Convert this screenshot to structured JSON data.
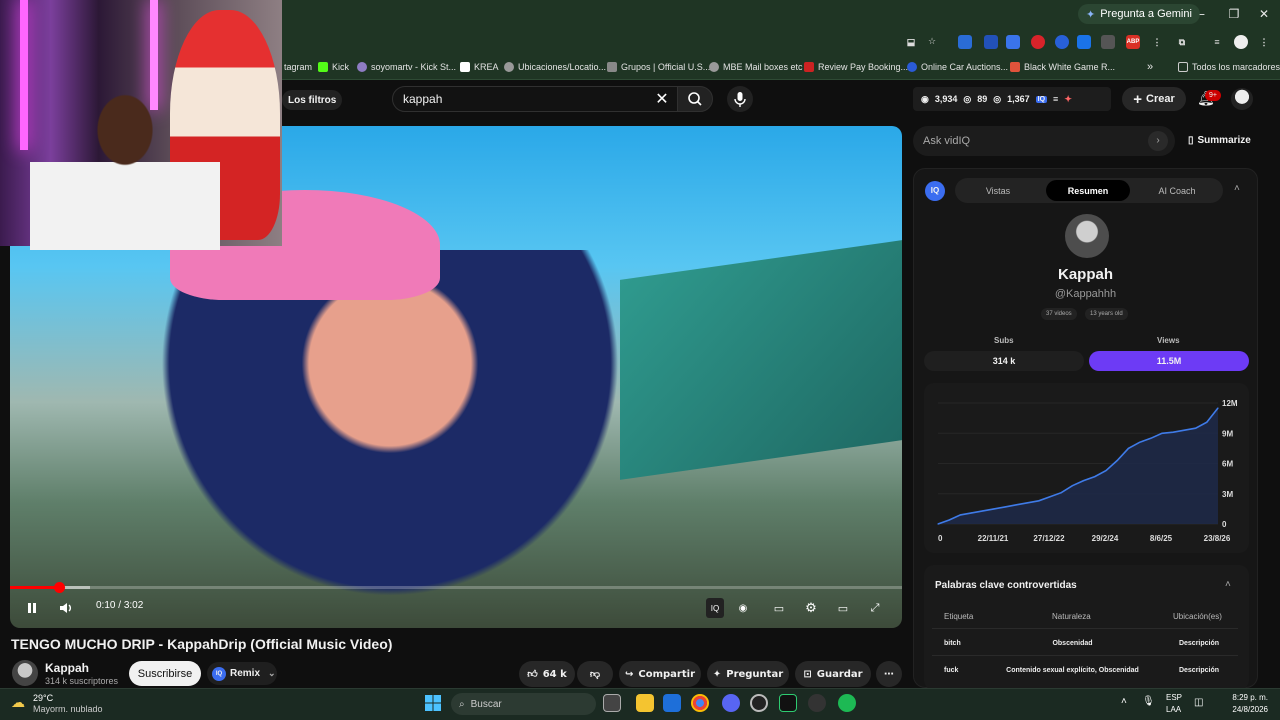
{
  "browser": {
    "gemini_label": "Pregunta a Gemini",
    "bookmarks": [
      "tagram",
      "Kick",
      "soyomartv - Kick St...",
      "KREA",
      "Ubicaciones/Locatio...",
      "Grupos | Official U.S...",
      "MBE Mail boxes etc",
      "Review Pay Booking...",
      "Online Car Auctions...",
      "Black White Game R..."
    ],
    "all_bookmarks": "Todos los marcadores",
    "overflow": "»"
  },
  "header": {
    "filters_label": "Los filtros",
    "search_value": "kappah",
    "stats": {
      "subs": "3,934",
      "eye": "89",
      "views": "1,367"
    },
    "create_label": "Crear",
    "notif_count": "9+"
  },
  "player": {
    "time_current": "0:10",
    "time_total": "3:02",
    "time_sep": " / ",
    "progress_fraction": 0.055,
    "buffer_fraction": 0.09
  },
  "video": {
    "title": "TENGO MUCHO DRIP - KappahDrip (Official Music Video)",
    "channel": "Kappah",
    "subscribers": "314 k suscriptores",
    "subscribe_label": "Suscribirse",
    "remix_label": "Remix",
    "likes": "64 k",
    "share_label": "Compartir",
    "ask_label": "Preguntar",
    "save_label": "Guardar"
  },
  "sidebar": {
    "ask_placeholder": "Ask vidIQ",
    "summarize_label": "Summarize",
    "tabs": [
      "Vistas",
      "Resumen",
      "AI Coach"
    ],
    "active_tab": 1,
    "channel_name": "Kappah",
    "channel_handle": "@Kappahhh",
    "chip_videos": "37 videos",
    "chip_age": "13 years old",
    "subs_label": "Subs",
    "views_label": "Views",
    "subs_value": "314 k",
    "views_value": "11.5M",
    "keywords_title": "Palabras clave controvertidas",
    "keywords_headers": [
      "Etiqueta",
      "Naturaleza",
      "Ubicación(es)"
    ],
    "keywords_rows": [
      [
        "bitch",
        "Obscenidad",
        "Descripción"
      ],
      [
        "fuck",
        "Contenido sexual explícito, Obscenidad",
        "Descripción"
      ]
    ]
  },
  "chart_data": {
    "type": "area",
    "title": "",
    "xlabel": "",
    "ylabel": "",
    "x_ticks": [
      "0",
      "22/11/21",
      "27/12/22",
      "29/2/24",
      "8/6/25",
      "23/8/26"
    ],
    "y_ticks": [
      "0",
      "3M",
      "6M",
      "9M",
      "12M"
    ],
    "ylim": [
      0,
      12000000
    ],
    "series": [
      {
        "x": [
          0,
          0.04,
          0.08,
          0.12,
          0.16,
          0.2,
          0.24,
          0.28,
          0.32,
          0.36,
          0.4,
          0.44,
          0.48,
          0.52,
          0.56,
          0.6,
          0.64,
          0.68,
          0.72,
          0.76,
          0.8,
          0.84,
          0.88,
          0.92,
          0.96,
          1.0
        ],
        "values": [
          0,
          400000,
          900000,
          1100000,
          1300000,
          1500000,
          1700000,
          1900000,
          2100000,
          2300000,
          2700000,
          3100000,
          3800000,
          4300000,
          4700000,
          5300000,
          6300000,
          7500000,
          8100000,
          8500000,
          9000000,
          9100000,
          9300000,
          9500000,
          10100000,
          11500000
        ]
      }
    ],
    "color": "#6d3bf5"
  },
  "taskbar": {
    "temp": "29°C",
    "weather": "Mayorm. nublado",
    "search_placeholder": "Buscar",
    "lang1": "ESP",
    "lang2": "LAA",
    "time": "8:29 p. m.",
    "date": "24/8/2026"
  }
}
